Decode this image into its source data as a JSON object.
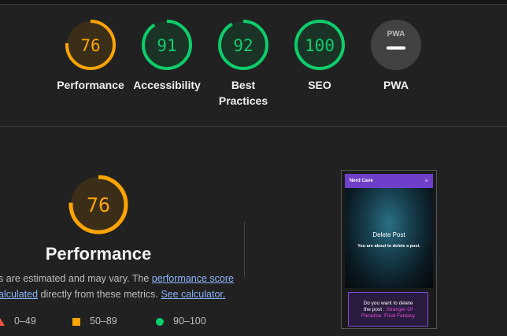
{
  "gauges": [
    {
      "id": "performance",
      "score": "76",
      "label": "Performance",
      "color": "#ffa400",
      "fill": 0.76
    },
    {
      "id": "accessibility",
      "score": "91",
      "label": "Accessibility",
      "color": "#0cce6b",
      "fill": 0.91
    },
    {
      "id": "best-practices",
      "score": "92",
      "label": "Best\nPractices",
      "color": "#0cce6b",
      "fill": 0.92
    },
    {
      "id": "seo",
      "score": "100",
      "label": "SEO",
      "color": "#0cce6b",
      "fill": 1.0
    },
    {
      "id": "pwa",
      "score": "",
      "label": "PWA",
      "badge": "PWA"
    }
  ],
  "main": {
    "score": "76",
    "title": "Performance",
    "desc_line1_prefix": "s are estimated and may vary. The ",
    "desc_link1": "performance score",
    "desc_link2": "alculated",
    "desc_line2_mid": " directly from these metrics. ",
    "desc_link3": "See calculator."
  },
  "legend": [
    {
      "range": "0–49",
      "color": "#ff4e42"
    },
    {
      "range": "50–89",
      "color": "#ffa400"
    },
    {
      "range": "90–100",
      "color": "#0cce6b"
    }
  ],
  "screenshot": {
    "brand": "Nerd Cave",
    "menu_icon": "≡",
    "hero_title": "Delete Post",
    "hero_sub": "You are about to delete a post.",
    "card_line1": "Do you want to delete",
    "card_line2_prefix": "the post : ",
    "card_line2_highlight": "Stranger Of",
    "card_line3": "Paradise: Final Fantasy"
  }
}
